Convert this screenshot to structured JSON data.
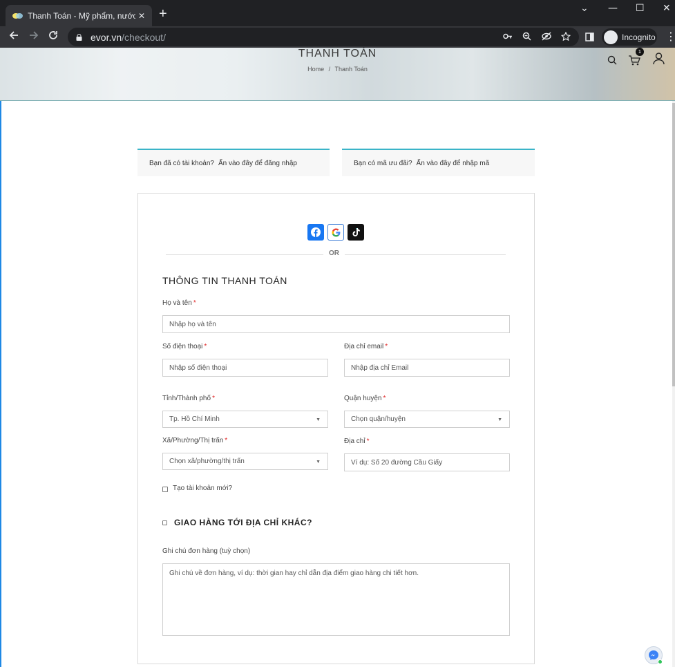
{
  "browser": {
    "tab_title": "Thanh Toán - Mỹ phẩm, nước hoa",
    "tab_close": "✕",
    "new_tab": "+",
    "url_host": "evor.vn",
    "url_path": "/checkout/",
    "incognito_label": "Incognito",
    "window_controls": [
      "⌄",
      "—",
      "☐",
      "✕"
    ]
  },
  "header": {
    "title": "THANH TOÁN",
    "breadcrumb_home": "Home",
    "breadcrumb_sep": "/",
    "breadcrumb_current": "Thanh Toán",
    "cart_count": "1"
  },
  "notices": {
    "login_question": "Bạn đã có tài khoản?",
    "login_link": "Ấn vào đây để đăng nhập",
    "coupon_question": "Bạn có mã ưu đãi?",
    "coupon_link": "Ấn vào đây để nhập mã"
  },
  "social": {
    "or_text": "OR",
    "facebook_color": "#1877f2",
    "tiktok_color": "#111111"
  },
  "form": {
    "section_title": "THÔNG TIN THANH TOÁN",
    "required_mark": "*",
    "full_name": {
      "label": "Họ và tên",
      "placeholder": "Nhập họ và tên"
    },
    "phone": {
      "label": "Số điện thoại",
      "placeholder": "Nhập số điện thoại"
    },
    "email": {
      "label": "Địa chỉ email",
      "placeholder": "Nhập địa chỉ Email"
    },
    "province": {
      "label": "Tỉnh/Thành phố",
      "value": "Tp. Hồ Chí Minh"
    },
    "district": {
      "label": "Quận huyện",
      "value": "Chọn quận/huyện"
    },
    "ward": {
      "label": "Xã/Phường/Thị trấn",
      "value": "Chọn xã/phường/thị trấn"
    },
    "address": {
      "label": "Địa chỉ",
      "placeholder": "Ví dụ: Số 20 đường Cầu Giấy"
    },
    "create_account_label": "Tạo tài khoản mới?",
    "ship_different_label": "GIAO HÀNG TỚI ĐỊA CHỈ KHÁC?",
    "notes": {
      "label": "Ghi chú đơn hàng (tuỳ chọn)",
      "placeholder": "Ghi chú về đơn hàng, ví dụ: thời gian hay chỉ dẫn địa điểm giao hàng chi tiết hơn."
    }
  }
}
